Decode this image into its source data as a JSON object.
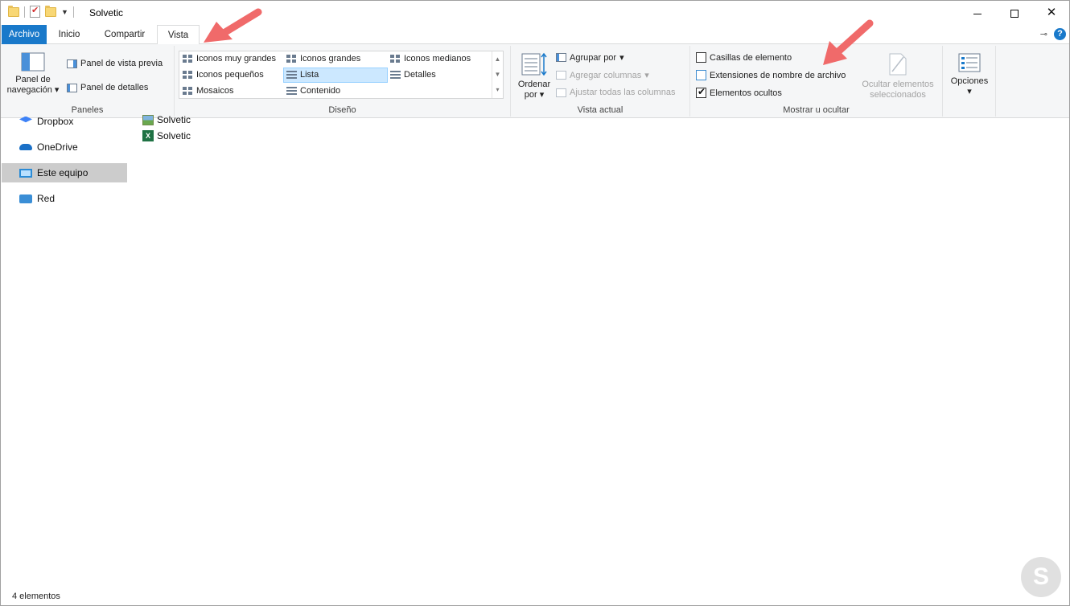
{
  "window": {
    "title": "Solvetic"
  },
  "tabs": [
    {
      "label": "Archivo"
    },
    {
      "label": "Inicio"
    },
    {
      "label": "Compartir"
    },
    {
      "label": "Vista"
    }
  ],
  "ribbon": {
    "panes": {
      "nav_pane_line1": "Panel de",
      "nav_pane_line2": "navegación",
      "preview": "Panel de vista previa",
      "details": "Panel de detalles",
      "group": "Paneles"
    },
    "layout": {
      "items": [
        "Iconos muy grandes",
        "Iconos grandes",
        "Iconos medianos",
        "Iconos pequeños",
        "Lista",
        "Detalles",
        "Mosaicos",
        "Contenido"
      ],
      "selected": "Lista",
      "group": "Diseño"
    },
    "current_view": {
      "sort_line1": "Ordenar",
      "sort_line2": "por",
      "group_by": "Agrupar por",
      "add_columns": "Agregar columnas",
      "fit_columns": "Ajustar todas las columnas",
      "group": "Vista actual"
    },
    "show_hide": {
      "item_checkboxes": "Casillas de elemento",
      "file_extensions": "Extensiones de nombre de archivo",
      "hidden_items": "Elementos ocultos",
      "hide_selected_line1": "Ocultar elementos",
      "hide_selected_line2": "seleccionados",
      "group": "Mostrar u ocultar",
      "item_checkboxes_checked": false,
      "file_extensions_checked": false,
      "hidden_items_checked": true
    },
    "options": {
      "label": "Opciones"
    }
  },
  "nav": {
    "items": [
      {
        "label": "Dropbox",
        "icon": "dropbox-icon"
      },
      {
        "label": "OneDrive",
        "icon": "onedrive-icon"
      },
      {
        "label": "Este equipo",
        "icon": "pc-icon"
      },
      {
        "label": "Red",
        "icon": "network-icon"
      }
    ],
    "selected": "Este equipo"
  },
  "files": [
    {
      "name": "Solvetic",
      "icon": "image-file-icon"
    },
    {
      "name": "Solvetic",
      "icon": "excel-file-icon"
    }
  ],
  "status": {
    "count": "4 elementos"
  },
  "colors": {
    "accent": "#1979ca",
    "arrow": "#f06a6a",
    "selection": "#cce8ff"
  }
}
